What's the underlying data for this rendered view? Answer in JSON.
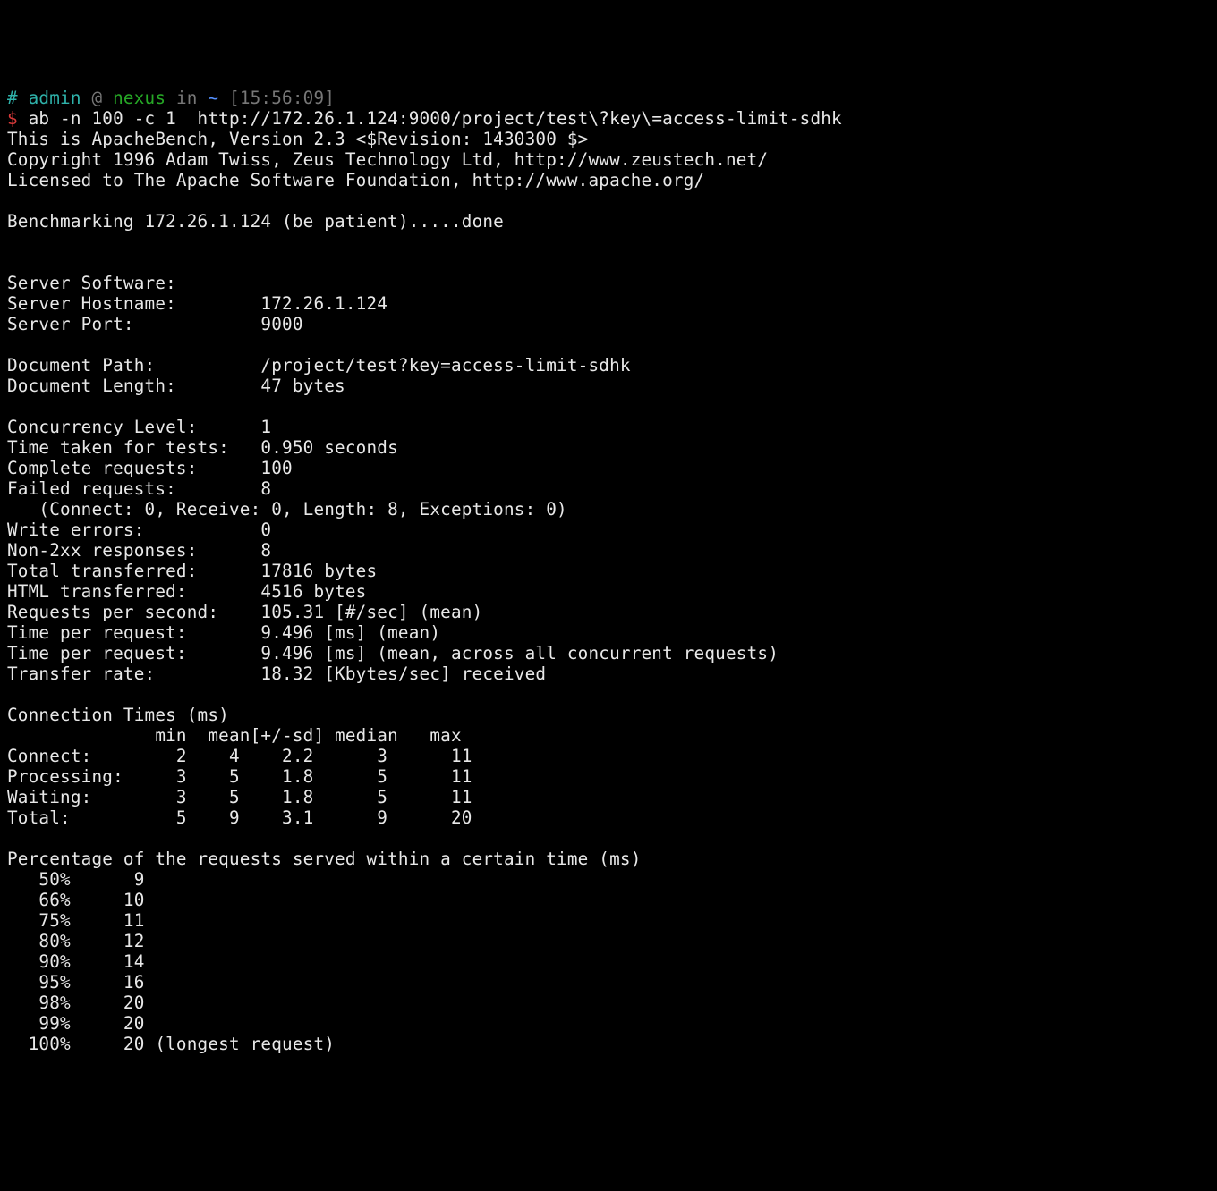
{
  "prompt": {
    "hash": "# ",
    "user": "admin",
    "at": " @ ",
    "host": "nexus",
    "inword": " in ",
    "cwd": "~",
    "time": " [15:56:09]",
    "dollar": "$ ",
    "command": "ab -n 100 -c 1  http://172.26.1.124:9000/project/test\\?key\\=access-limit-sdhk"
  },
  "header": {
    "l1": "This is ApacheBench, Version 2.3 <$Revision: 1430300 $>",
    "l2": "Copyright 1996 Adam Twiss, Zeus Technology Ltd, http://www.zeustech.net/",
    "l3": "Licensed to The Apache Software Foundation, http://www.apache.org/"
  },
  "bench": "Benchmarking 172.26.1.124 (be patient).....done",
  "srv": {
    "software_lbl": "Server Software:",
    "software_val": "",
    "host_lbl": "Server Hostname:",
    "host_val": "172.26.1.124",
    "port_lbl": "Server Port:",
    "port_val": "9000"
  },
  "doc": {
    "path_lbl": "Document Path:",
    "path_val": "/project/test?key=access-limit-sdhk",
    "len_lbl": "Document Length:",
    "len_val": "47 bytes"
  },
  "stats": {
    "conc_lbl": "Concurrency Level:",
    "conc_val": "1",
    "time_lbl": "Time taken for tests:",
    "time_val": "0.950 seconds",
    "compl_lbl": "Complete requests:",
    "compl_val": "100",
    "fail_lbl": "Failed requests:",
    "fail_val": "8",
    "fail_detail": "   (Connect: 0, Receive: 0, Length: 8, Exceptions: 0)",
    "we_lbl": "Write errors:",
    "we_val": "0",
    "n2xx_lbl": "Non-2xx responses:",
    "n2xx_val": "8",
    "tot_lbl": "Total transferred:",
    "tot_val": "17816 bytes",
    "html_lbl": "HTML transferred:",
    "html_val": "4516 bytes",
    "rps_lbl": "Requests per second:",
    "rps_val": "105.31 [#/sec] (mean)",
    "tpr1_lbl": "Time per request:",
    "tpr1_val": "9.496 [ms] (mean)",
    "tpr2_lbl": "Time per request:",
    "tpr2_val": "9.496 [ms] (mean, across all concurrent requests)",
    "tr_lbl": "Transfer rate:",
    "tr_val": "18.32 [Kbytes/sec] received"
  },
  "ct": {
    "title": "Connection Times (ms)",
    "hdr": "              min  mean[+/-sd] median   max",
    "rows": [
      {
        "lbl": "Connect:",
        "min": "2",
        "mean": "4",
        "sd": "2.2",
        "med": "3",
        "max": "11"
      },
      {
        "lbl": "Processing:",
        "min": "3",
        "mean": "5",
        "sd": "1.8",
        "med": "5",
        "max": "11"
      },
      {
        "lbl": "Waiting:",
        "min": "3",
        "mean": "5",
        "sd": "1.8",
        "med": "5",
        "max": "11"
      },
      {
        "lbl": "Total:",
        "min": "5",
        "mean": "9",
        "sd": "3.1",
        "med": "9",
        "max": "20"
      }
    ]
  },
  "pct": {
    "title": "Percentage of the requests served within a certain time (ms)",
    "rows": [
      {
        "p": "50%",
        "v": "9",
        "suffix": ""
      },
      {
        "p": "66%",
        "v": "10",
        "suffix": ""
      },
      {
        "p": "75%",
        "v": "11",
        "suffix": ""
      },
      {
        "p": "80%",
        "v": "12",
        "suffix": ""
      },
      {
        "p": "90%",
        "v": "14",
        "suffix": ""
      },
      {
        "p": "95%",
        "v": "16",
        "suffix": ""
      },
      {
        "p": "98%",
        "v": "20",
        "suffix": ""
      },
      {
        "p": "99%",
        "v": "20",
        "suffix": ""
      },
      {
        "p": "100%",
        "v": "20",
        "suffix": " (longest request)"
      }
    ]
  }
}
